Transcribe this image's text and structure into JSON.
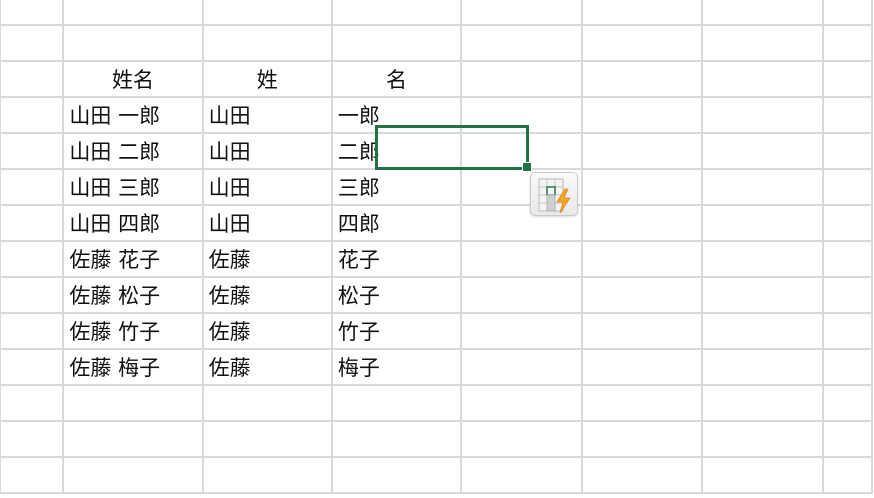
{
  "columns": {
    "b_header": "姓名",
    "c_header": "姓",
    "d_header": "名"
  },
  "rows": [
    {
      "full_name": "山田 一郎",
      "last_name": "山田",
      "first_name": "一郎"
    },
    {
      "full_name": "山田 二郎",
      "last_name": "山田",
      "first_name": "二郎"
    },
    {
      "full_name": "山田 三郎",
      "last_name": "山田",
      "first_name": "三郎"
    },
    {
      "full_name": "山田 四郎",
      "last_name": "山田",
      "first_name": "四郎"
    },
    {
      "full_name": "佐藤 花子",
      "last_name": "佐藤",
      "first_name": "花子"
    },
    {
      "full_name": "佐藤 松子",
      "last_name": "佐藤",
      "first_name": "松子"
    },
    {
      "full_name": "佐藤 竹子",
      "last_name": "佐藤",
      "first_name": "竹子"
    },
    {
      "full_name": "佐藤 梅子",
      "last_name": "佐藤",
      "first_name": "梅子"
    }
  ],
  "selection": {
    "active_cell_value": "二郎"
  },
  "flash_fill": {
    "icon": "flash-fill-icon",
    "accent_color": "#217346",
    "bolt_color": "#f5a623"
  },
  "colors": {
    "gridline": "#d9d9d9",
    "selection": "#217346",
    "text": "#111111"
  }
}
